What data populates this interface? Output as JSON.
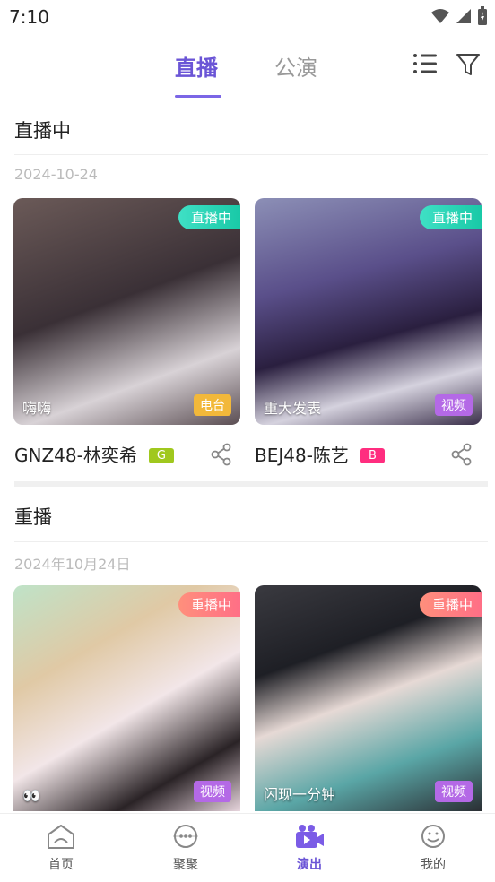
{
  "status_bar": {
    "time": "7:10"
  },
  "top_tabs": {
    "live": "直播",
    "public": "公演"
  },
  "sections": {
    "live": {
      "title": "直播中",
      "date": "2024-10-24",
      "cards": [
        {
          "badge": "直播中",
          "caption": "嗨嗨",
          "type": "电台",
          "name": "GNZ48-林奕希",
          "group": "G",
          "group_color": "#a0c81e"
        },
        {
          "badge": "直播中",
          "caption": "重大发表",
          "type": "视频",
          "name": "BEJ48-陈艺",
          "group": "B",
          "group_color": "#ff2d7f"
        }
      ]
    },
    "replay": {
      "title": "重播",
      "date": "2024年10月24日",
      "cards": [
        {
          "badge": "重播中",
          "caption": "👀",
          "type": "视频"
        },
        {
          "badge": "重播中",
          "caption": "闪现一分钟",
          "type": "视频"
        }
      ]
    }
  },
  "bottom_nav": [
    {
      "label": "首页",
      "icon": "home-icon"
    },
    {
      "label": "聚聚",
      "icon": "chat-icon"
    },
    {
      "label": "演出",
      "icon": "video-camera-icon"
    },
    {
      "label": "我的",
      "icon": "profile-icon"
    }
  ],
  "colors": {
    "accent": "#6b55d6",
    "live_badge": "#19c9a7",
    "replay_badge": "#ff6f86",
    "radio_tag": "#f2b83a",
    "video_tag": "#b469e6"
  }
}
